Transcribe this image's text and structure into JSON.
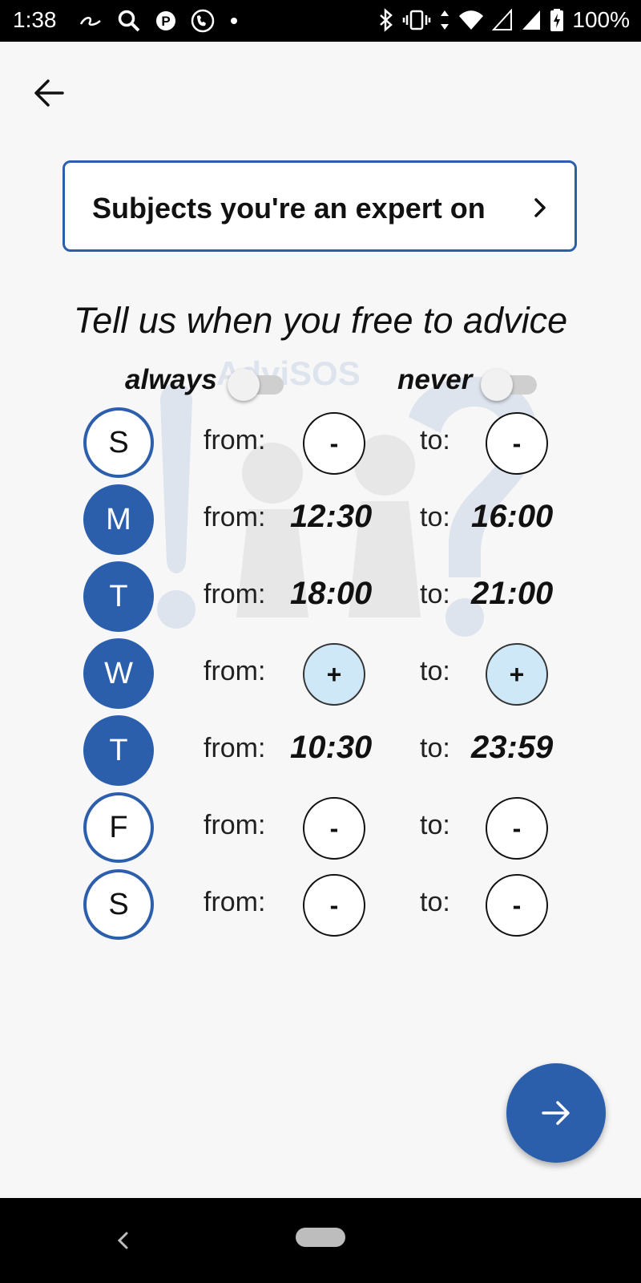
{
  "status_bar": {
    "time": "1:38",
    "left_icons": [
      "alibaba-icon",
      "search-icon",
      "parking-icon",
      "phone-call-icon",
      "notification-dot-icon"
    ],
    "right_icons": [
      "bluetooth-icon",
      "vibrate-icon",
      "data-arrows-icon",
      "wifi-icon",
      "signal-icon",
      "signal-icon",
      "battery-charging-icon"
    ],
    "battery_text": "100%"
  },
  "header": {
    "back_icon": "arrow-back-icon"
  },
  "subjects_card": {
    "label": "Subjects you're an expert on",
    "icon": "chevron-right-icon"
  },
  "heading": "Tell us when you free to advice",
  "toggles": {
    "always": {
      "label": "always",
      "on": false
    },
    "never": {
      "label": "never",
      "on": false
    }
  },
  "watermark_text": "AdviSOS",
  "labels": {
    "from": "from:",
    "to": "to:"
  },
  "days": [
    {
      "letter": "S",
      "active": false,
      "from": "-",
      "to": "-"
    },
    {
      "letter": "M",
      "active": true,
      "from": "12:30",
      "to": "16:00"
    },
    {
      "letter": "T",
      "active": true,
      "from": "18:00",
      "to": "21:00"
    },
    {
      "letter": "W",
      "active": true,
      "from": "+",
      "to": "+"
    },
    {
      "letter": "T",
      "active": true,
      "from": "10:30",
      "to": "23:59"
    },
    {
      "letter": "F",
      "active": false,
      "from": "-",
      "to": "-"
    },
    {
      "letter": "S",
      "active": false,
      "from": "-",
      "to": "-"
    }
  ],
  "fab": {
    "icon": "arrow-forward-icon"
  },
  "nav_bar": {
    "back_icon": "nav-back-icon",
    "home_icon": "home-pill-icon"
  },
  "colors": {
    "accent": "#2b5fac",
    "plus_fill": "#cfe8f8",
    "background": "#f7f7f7"
  }
}
